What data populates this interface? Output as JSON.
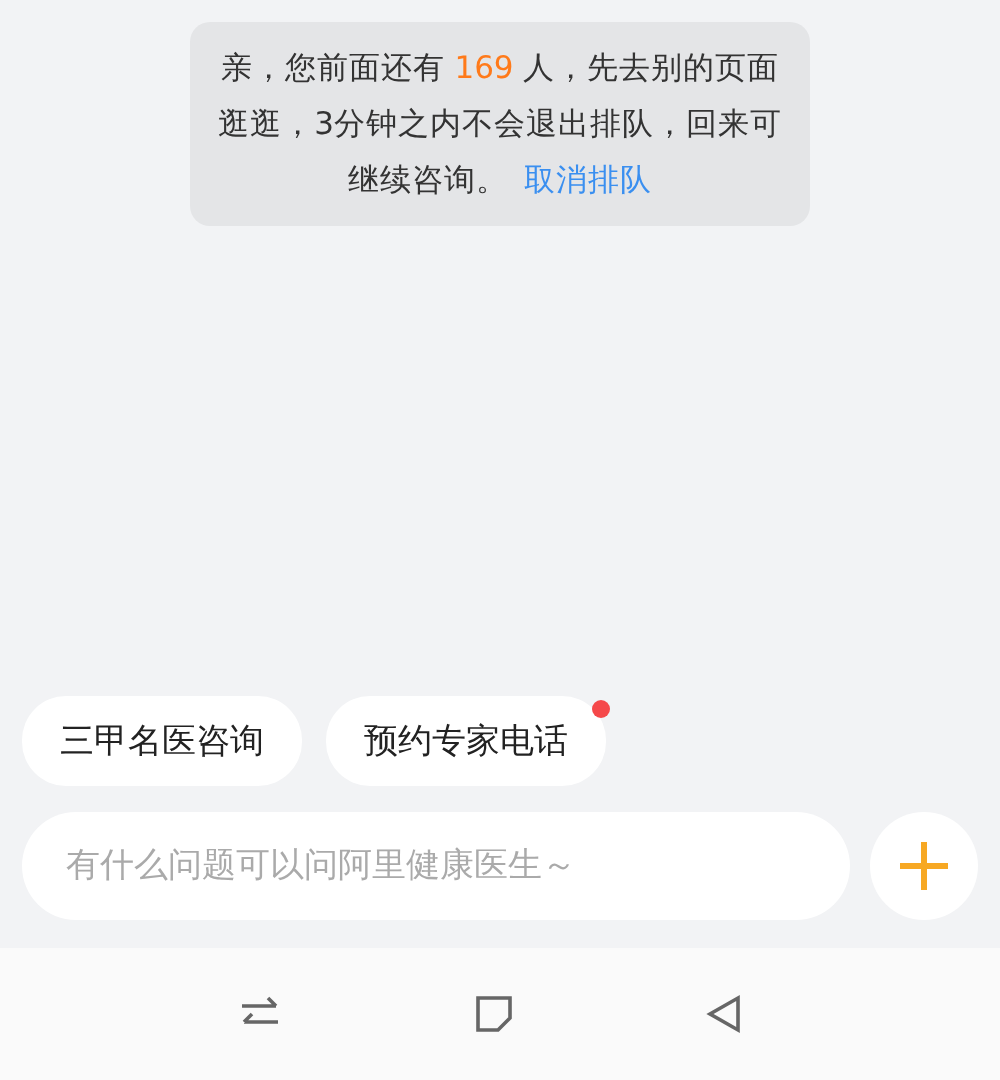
{
  "queue_notice": {
    "text_before": "亲，您前面还有 ",
    "count": "169",
    "text_after": " 人，先去别的页面逛逛，3分钟之内不会退出排队，回来可继续咨询。",
    "link": "取消排队"
  },
  "quick_replies": [
    {
      "label": "三甲名医咨询",
      "badge": false
    },
    {
      "label": "预约专家电话",
      "badge": true
    }
  ],
  "input": {
    "placeholder": "有什么问题可以问阿里健康医生～"
  }
}
